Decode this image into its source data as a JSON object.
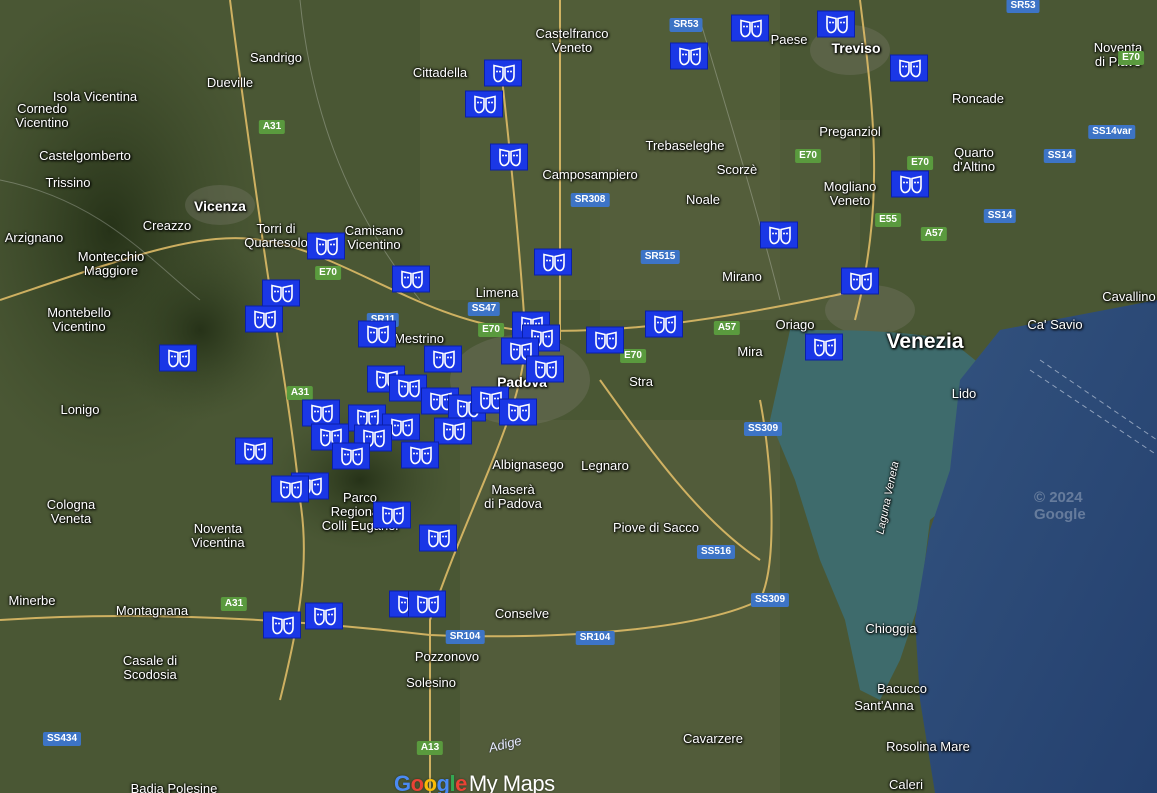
{
  "map": {
    "colors": {
      "land": "#4a5734",
      "sea": "#2d4a7a",
      "lagoon": "#3c6a73",
      "marker": "#1a37e6",
      "road": "#e6c16a"
    },
    "places": [
      {
        "text": "Sandrigo",
        "kind": "town"
      },
      {
        "text": "Dueville",
        "kind": "town"
      },
      {
        "text": "Isola Vicentina",
        "kind": "town"
      },
      {
        "text": "Cornedo\nVicentino",
        "kind": "town"
      },
      {
        "text": "Castelgomberto",
        "kind": "town"
      },
      {
        "text": "Trissino",
        "kind": "town"
      },
      {
        "text": "Vicenza",
        "kind": "city"
      },
      {
        "text": "Creazzo",
        "kind": "town"
      },
      {
        "text": "Torri di\nQuartesolo",
        "kind": "town"
      },
      {
        "text": "Camisano\nVicentino",
        "kind": "town"
      },
      {
        "text": "Arzignano",
        "kind": "town"
      },
      {
        "text": "Montecchio\nMaggiore",
        "kind": "town"
      },
      {
        "text": "Montebello\nVicentino",
        "kind": "town"
      },
      {
        "text": "Lonigo",
        "kind": "town"
      },
      {
        "text": "Cologna\nVeneta",
        "kind": "town"
      },
      {
        "text": "Noventa\nVicentina",
        "kind": "town"
      },
      {
        "text": "Minerbe",
        "kind": "town"
      },
      {
        "text": "Montagnana",
        "kind": "town"
      },
      {
        "text": "Casale di\nScodosia",
        "kind": "town"
      },
      {
        "text": "Badia Polesine",
        "kind": "town"
      },
      {
        "text": "Cittadella",
        "kind": "town"
      },
      {
        "text": "Castelfranco\nVeneto",
        "kind": "town"
      },
      {
        "text": "Camposampiero",
        "kind": "town"
      },
      {
        "text": "Trebaseleghe",
        "kind": "town"
      },
      {
        "text": "Scorzè",
        "kind": "town"
      },
      {
        "text": "Noale",
        "kind": "town"
      },
      {
        "text": "Paese",
        "kind": "town"
      },
      {
        "text": "Treviso",
        "kind": "city"
      },
      {
        "text": "Noventa\ndi Piave",
        "kind": "town"
      },
      {
        "text": "Roncade",
        "kind": "town"
      },
      {
        "text": "Preganziol",
        "kind": "town"
      },
      {
        "text": "Quarto\nd'Altino",
        "kind": "town"
      },
      {
        "text": "Mogliano\nVeneto",
        "kind": "town"
      },
      {
        "text": "Limena",
        "kind": "town"
      },
      {
        "text": "Mestrino",
        "kind": "town"
      },
      {
        "text": "Padova",
        "kind": "city"
      },
      {
        "text": "Stra",
        "kind": "town"
      },
      {
        "text": "Mira",
        "kind": "town"
      },
      {
        "text": "Mirano",
        "kind": "town"
      },
      {
        "text": "Oriago",
        "kind": "town"
      },
      {
        "text": "Venezia",
        "kind": "big"
      },
      {
        "text": "Ca' Savio",
        "kind": "town"
      },
      {
        "text": "Cavallino",
        "kind": "town"
      },
      {
        "text": "Lido",
        "kind": "town"
      },
      {
        "text": "Albignasego",
        "kind": "town"
      },
      {
        "text": "Legnaro",
        "kind": "town"
      },
      {
        "text": "Maserà\ndi Padova",
        "kind": "town"
      },
      {
        "text": "Parco\nRegionale\nColli Euganei",
        "kind": "town"
      },
      {
        "text": "Piove di Sacco",
        "kind": "town"
      },
      {
        "text": "Conselve",
        "kind": "town"
      },
      {
        "text": "Pozzonovo",
        "kind": "town"
      },
      {
        "text": "Solesino",
        "kind": "town"
      },
      {
        "text": "Cavarzere",
        "kind": "town"
      },
      {
        "text": "Chioggia",
        "kind": "town"
      },
      {
        "text": "Bacucco",
        "kind": "town"
      },
      {
        "text": "Sant'Anna",
        "kind": "town"
      },
      {
        "text": "Rosolina Mare",
        "kind": "town"
      },
      {
        "text": "Caleri",
        "kind": "town"
      },
      {
        "text": "Laguna Veneta",
        "kind": "sea"
      },
      {
        "text": "Stra",
        "kind": "hidden"
      }
    ],
    "shields": [
      {
        "text": "SR53",
        "color": "blue"
      },
      {
        "text": "SR53",
        "color": "blue"
      },
      {
        "text": "E70",
        "color": "green"
      },
      {
        "text": "A31",
        "color": "green"
      },
      {
        "text": "SR308",
        "color": "blue"
      },
      {
        "text": "SR515",
        "color": "blue"
      },
      {
        "text": "E70",
        "color": "green"
      },
      {
        "text": "E55",
        "color": "green"
      },
      {
        "text": "A57",
        "color": "green"
      },
      {
        "text": "SS14",
        "color": "blue"
      },
      {
        "text": "SS14",
        "color": "blue"
      },
      {
        "text": "SS14var",
        "color": "blue"
      },
      {
        "text": "E70",
        "color": "green"
      },
      {
        "text": "SR11",
        "color": "blue"
      },
      {
        "text": "SS47",
        "color": "blue"
      },
      {
        "text": "E70",
        "color": "green"
      },
      {
        "text": "A57",
        "color": "green"
      },
      {
        "text": "E70",
        "color": "green"
      },
      {
        "text": "A31",
        "color": "green"
      },
      {
        "text": "SS309",
        "color": "blue"
      },
      {
        "text": "SS516",
        "color": "blue"
      },
      {
        "text": "SS309",
        "color": "blue"
      },
      {
        "text": "A31",
        "color": "green"
      },
      {
        "text": "SR104",
        "color": "blue"
      },
      {
        "text": "SR104",
        "color": "blue"
      },
      {
        "text": "SS434",
        "color": "blue"
      },
      {
        "text": "A13",
        "color": "green"
      },
      {
        "text": "E70",
        "color": "green"
      }
    ],
    "river_label": "Adige",
    "copyright": "© 2024 Google",
    "brand": {
      "letters": [
        "G",
        "o",
        "o",
        "g",
        "l",
        "e"
      ],
      "suffix": "My Maps"
    },
    "marker_count": 48,
    "marker_icon": "theatre-masks-icon"
  }
}
